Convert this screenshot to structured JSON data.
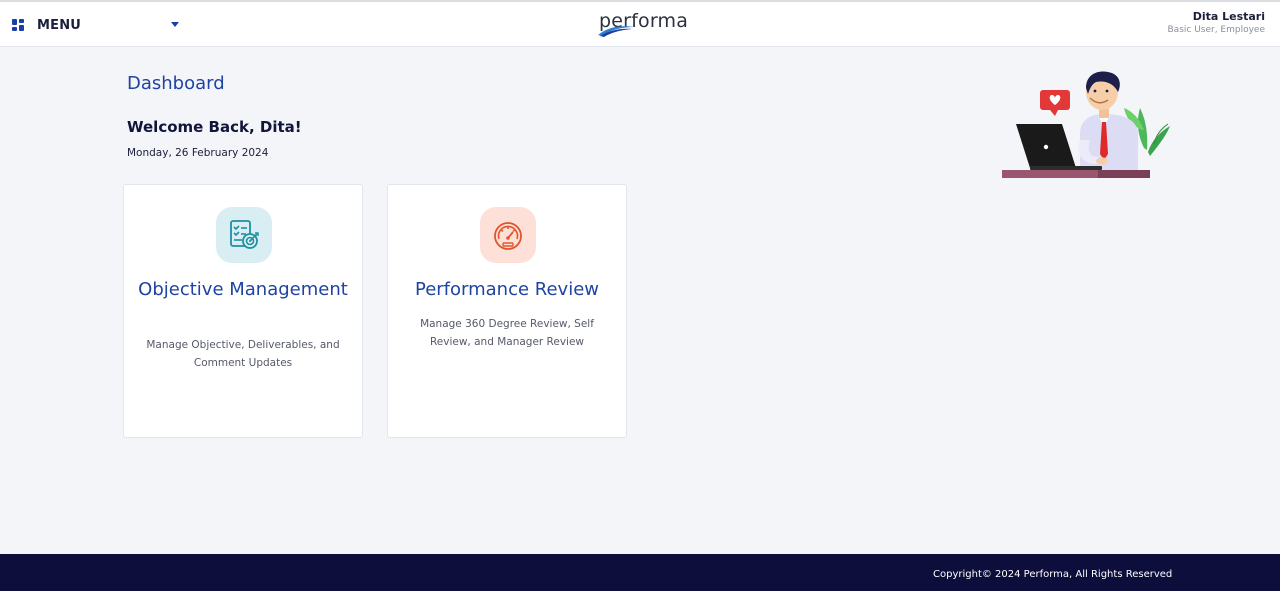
{
  "header": {
    "menu_label": "MENU",
    "logo_text": "performa",
    "user_name": "Dita Lestari",
    "user_role": "Basic User, Employee"
  },
  "main": {
    "page_title": "Dashboard",
    "welcome": "Welcome Back, Dita!",
    "date": "Monday, 26 February 2024",
    "cards": [
      {
        "title": "Objective Management",
        "description": "Manage Objective, Deliverables, and Comment Updates",
        "icon": "objective-checklist-icon",
        "icon_color": "#1f8fa3",
        "icon_bg": "#d8eef2"
      },
      {
        "title": "Performance Review",
        "description": "Manage 360 Degree Review, Self Review, and Manager Review",
        "icon": "speedometer-icon",
        "icon_color": "#e0552e",
        "icon_bg": "#fde1d9"
      }
    ]
  },
  "footer": {
    "copyright": "Copyright© 2024 Performa, All Rights Reserved"
  },
  "colors": {
    "accent": "#1e43a3",
    "footer_bg": "#0e0e3c",
    "page_bg": "#f4f5f9"
  }
}
